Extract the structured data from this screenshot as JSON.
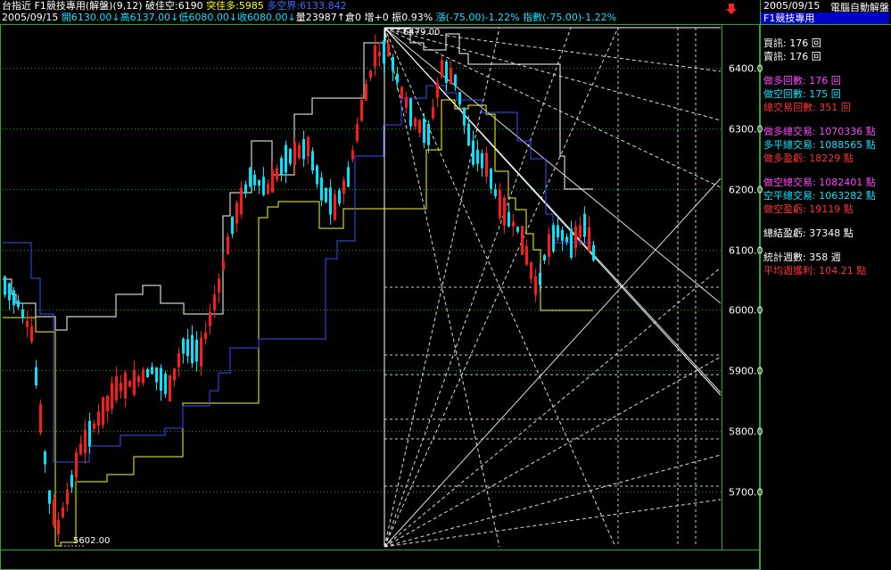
{
  "header": {
    "line1": [
      {
        "text": "台指近 F1競技專用(解盤)(9,12) ",
        "color": "white"
      },
      {
        "text": "破佳空:6190 ",
        "color": "white"
      },
      {
        "text": "突佳多:5985 ",
        "color": "yellow"
      },
      {
        "text": "多空界:6133.842",
        "color": "blue"
      }
    ],
    "line2": [
      {
        "text": "2005/09/15 ",
        "color": "white"
      },
      {
        "text": "開6130.00↓",
        "color": "cyan"
      },
      {
        "text": "高6137.00↓",
        "color": "cyan"
      },
      {
        "text": "低6080.00↓",
        "color": "cyan"
      },
      {
        "text": "收6080.00↓",
        "color": "cyan"
      },
      {
        "text": "量23987↑",
        "color": "white"
      },
      {
        "text": "倉0 ",
        "color": "white"
      },
      {
        "text": "增+0 ",
        "color": "white"
      },
      {
        "text": "振0.93% ",
        "color": "white"
      },
      {
        "text": "漲(-75.00)-1.22% ",
        "color": "cyan"
      },
      {
        "text": "指數(-75.00)-1.22%",
        "color": "cyan"
      }
    ]
  },
  "sidebar": {
    "date": "2005/09/15",
    "title": "電腦自動解盤",
    "subtitle": "F1競技專用",
    "rows": [
      {
        "text": "買訊: 176 回",
        "color": "white",
        "gap": 0
      },
      {
        "text": "賣訊: 176 回",
        "color": "white",
        "gap": 0
      },
      {
        "text": "做多回數: 176 回",
        "color": "magenta",
        "gap": 1
      },
      {
        "text": "做空回數: 175 回",
        "color": "cyan",
        "gap": 0
      },
      {
        "text": "總交易回數: 351 回",
        "color": "red",
        "gap": 0
      },
      {
        "text": "做多總交易: 1070336 點",
        "color": "magenta",
        "gap": 1
      },
      {
        "text": "多平總交易: 1088565 點",
        "color": "cyan",
        "gap": 0
      },
      {
        "text": "做多盈虧: 18229 點",
        "color": "red",
        "gap": 0
      },
      {
        "text": "做空總交易: 1082401 點",
        "color": "magenta",
        "gap": 1
      },
      {
        "text": "空平總交易: 1063282 點",
        "color": "cyan",
        "gap": 0
      },
      {
        "text": "做空盈虧: 19119 點",
        "color": "red",
        "gap": 0
      },
      {
        "text": "總結盈虧: 37348 點",
        "color": "white",
        "gap": 1
      },
      {
        "text": "統計週數: 358 週",
        "color": "white",
        "gap": 1
      },
      {
        "text": "平均週獲利: 104.21 點",
        "color": "red",
        "gap": 0
      }
    ]
  },
  "colors": {
    "white": "#ffffff",
    "yellow": "#ffff00",
    "cyan": "#00e5ff",
    "blue": "#3b6bff",
    "magenta": "#ff44ff",
    "red": "#ff3030",
    "green": "#00ff66",
    "bull": "#ff1a1a",
    "bear": "#00e5ff",
    "grid": "#00b800",
    "frame": "#2aa82a"
  },
  "chart_data": {
    "type": "candlestick",
    "y_ticks": [
      "6400.0",
      "6300.0",
      "6200.0",
      "6100.0",
      "6000.0",
      "5900.0",
      "5800.0",
      "5700.0"
    ],
    "ylim": [
      5602,
      6479
    ],
    "annotations": {
      "high_label": "6479.00",
      "low_label": "5602.00"
    },
    "high": 6479,
    "low": 5602,
    "close": 6080,
    "series": [
      {
        "name": "破佳空",
        "value": 6190
      },
      {
        "name": "突佳多",
        "value": 5985
      },
      {
        "name": "多空界",
        "value": 6133.842
      }
    ],
    "grid": "horizontal dotted",
    "gann_fan": true
  }
}
